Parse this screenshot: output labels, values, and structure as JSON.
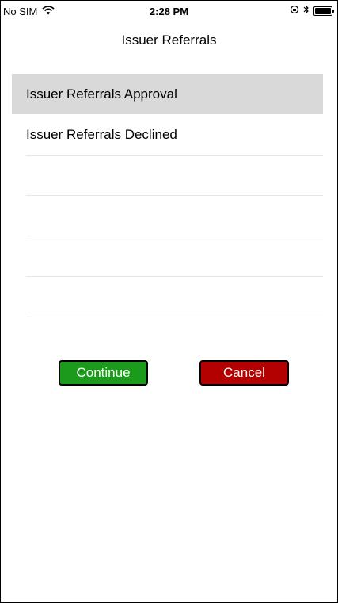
{
  "status_bar": {
    "carrier": "No SIM",
    "time": "2:28 PM"
  },
  "nav": {
    "title": "Issuer Referrals"
  },
  "list": {
    "items": [
      {
        "label": "Issuer Referrals Approval",
        "selected": true
      },
      {
        "label": "Issuer Referrals Declined",
        "selected": false
      }
    ]
  },
  "actions": {
    "continue_label": "Continue",
    "cancel_label": "Cancel"
  },
  "colors": {
    "continue": "#1b9a1b",
    "cancel": "#b30000",
    "selected_row": "#d9d9d9"
  },
  "icons": [
    "wifi-icon",
    "rotation-lock-icon",
    "bluetooth-icon",
    "battery-icon"
  ]
}
